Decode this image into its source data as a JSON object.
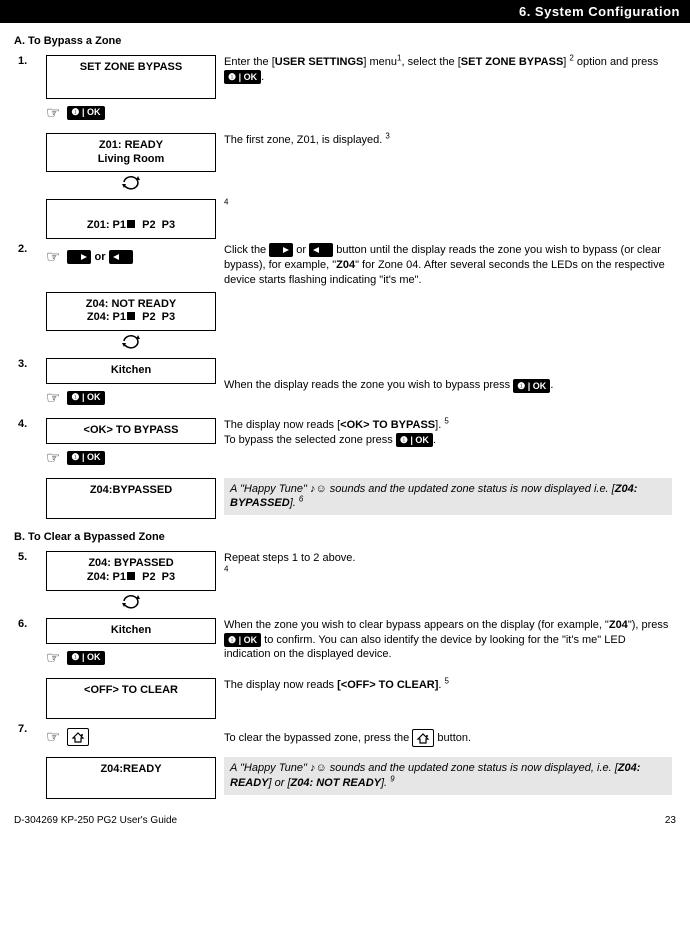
{
  "header": {
    "chapter": "6. System Configuration"
  },
  "sectionA": {
    "title": "A. To Bypass a Zone"
  },
  "sectionB": {
    "title": "B. To Clear a Bypassed Zone"
  },
  "ok": "❶ | OK",
  "steps": {
    "s1": {
      "num": "1.",
      "disp": "SET ZONE BYPASS",
      "desc_a": "Enter the [",
      "desc_b": "USER SETTINGS",
      "desc_c": "] menu",
      "sup1": "1",
      "desc_d": ", select the [",
      "desc_e": "SET ZONE BYPASS",
      "desc_f": "] ",
      "sup2": "2",
      "desc_g": " option and press ",
      "desc_h": "."
    },
    "s1b": {
      "disp1": "Z01: READY",
      "disp2": "Living Room",
      "desc": "The first zone, Z01, is displayed. ",
      "sup": "3"
    },
    "s1c": {
      "disp": "Z01: P1■   P2   P3",
      "sup": "4"
    },
    "s2": {
      "num": "2.",
      "or": " or ",
      "desc_a": "Click the ",
      "desc_b": " or ",
      "desc_c": " button until the display reads the zone you wish to bypass (or clear bypass), for example, \"",
      "desc_d": "Z04",
      "desc_e": "\" for Zone 04. After several seconds the LEDs on the respective device starts flashing indicating \"it's me\"."
    },
    "s2b": {
      "disp1": "Z04: NOT READY",
      "disp2": "Z04: P1■   P2   P3"
    },
    "s3": {
      "num": "3.",
      "disp": "Kitchen",
      "desc_a": "When the display reads the zone you wish to bypass press ",
      "desc_b": "."
    },
    "s4": {
      "num": "4.",
      "disp": "<OK> TO BYPASS",
      "desc_a": "The display now reads [",
      "desc_b": "<OK> TO BYPASS",
      "desc_c": "]. ",
      "sup": "5",
      "desc_d": "To bypass the selected zone press ",
      "desc_e": "."
    },
    "s4b": {
      "disp": "Z04:BYPASSED",
      "desc_a": "A \"Happy Tune\" ",
      "emoji": "♪☺",
      "desc_b": " sounds and the updated zone status is now displayed i.e. [",
      "desc_c": "Z04: BYPASSED",
      "desc_d": "]. ",
      "sup": "6"
    },
    "s5": {
      "num": "5.",
      "disp1": "Z04: BYPASSED",
      "disp2": "Z04: P1■   P2   P3",
      "desc": "Repeat steps 1 to 2 above.",
      "sup": "4"
    },
    "s6": {
      "num": "6.",
      "disp": "Kitchen",
      "desc_a": "When the zone you wish to clear bypass appears on the display (for example, \"",
      "desc_b": "Z04",
      "desc_c": "\"), press ",
      "desc_d": " to confirm. You can also identify the device by looking for the \"it's me\" LED indication on the displayed device."
    },
    "s6b": {
      "disp": "<OFF> TO CLEAR",
      "desc_a": "The display now reads ",
      "desc_b": "[<OFF> TO CLEAR]",
      "desc_c": ". ",
      "sup": "5"
    },
    "s7": {
      "num": "7.",
      "desc_a": "To clear the bypassed zone, press the ",
      "desc_b": " button."
    },
    "s7b": {
      "disp": "Z04:READY",
      "desc_a": "A \"Happy Tune\" ",
      "emoji": "♪☺",
      "desc_b": " sounds and the updated zone status is now displayed, i.e. [",
      "desc_c": "Z04: READY",
      "desc_d": "] or [",
      "desc_e": "Z04: NOT READY",
      "desc_f": "]. ",
      "sup": "9"
    }
  },
  "footer": {
    "left": "D-304269 KP-250 PG2 User's Guide",
    "right": "23"
  }
}
